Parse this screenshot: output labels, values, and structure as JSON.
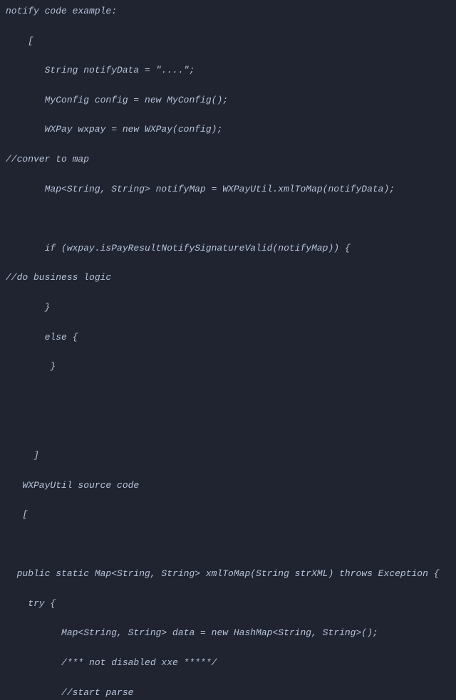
{
  "code": {
    "lines": [
      "notify code example:",
      "",
      "    [",
      "",
      "       String notifyData = \"....\";",
      "",
      "       MyConfig config = new MyConfig();",
      "",
      "       WXPay wxpay = new WXPay(config);",
      "",
      "//conver to map",
      "",
      "       Map<String, String> notifyMap = WXPayUtil.xmlToMap(notifyData);",
      "",
      "",
      "",
      "       if (wxpay.isPayResultNotifySignatureValid(notifyMap)) {",
      "",
      "//do business logic",
      "",
      "       }",
      "",
      "       else {",
      "",
      "        }",
      "",
      "",
      "",
      "",
      "",
      "     ]",
      "",
      "   WXPayUtil source code",
      "",
      "   [",
      "",
      "",
      "",
      "  public static Map<String, String> xmlToMap(String strXML) throws Exception {",
      "",
      "    try {",
      "",
      "          Map<String, String> data = new HashMap<String, String>();",
      "",
      "          /*** not disabled xxe *****/",
      "",
      "          //start parse"
    ]
  }
}
